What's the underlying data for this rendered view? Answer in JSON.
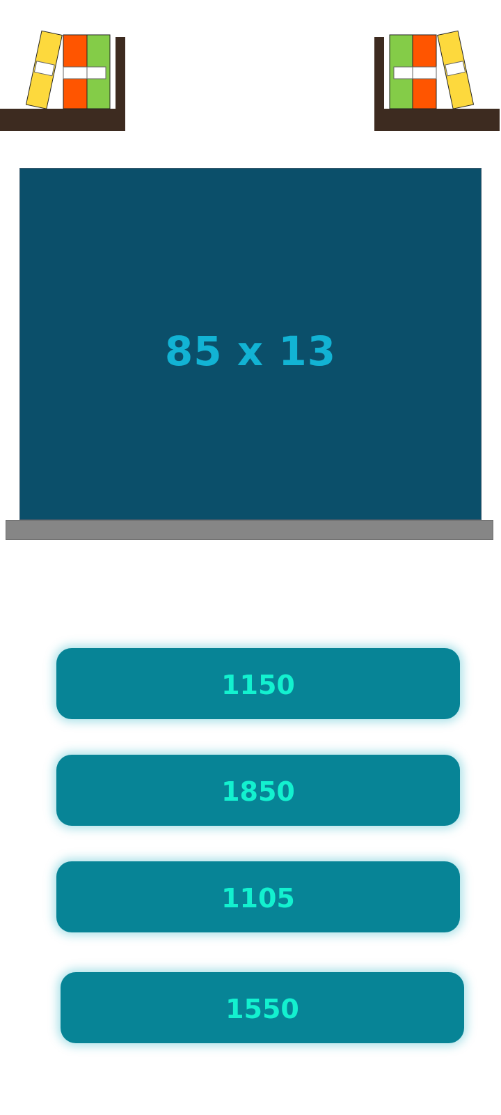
{
  "question": {
    "text": "85 x 13"
  },
  "answers": [
    {
      "label": "1150"
    },
    {
      "label": "1850"
    },
    {
      "label": "1105"
    },
    {
      "label": "1550"
    }
  ],
  "colors": {
    "board": "#0b4f6a",
    "question_text": "#12b3d4",
    "ledge": "#868686",
    "button": "#078496",
    "button_text": "#13f1cf",
    "shelf": "#3d2b20",
    "book_yellow": "#fdd93d",
    "book_orange": "#ff5500",
    "book_green": "#84cc48"
  }
}
